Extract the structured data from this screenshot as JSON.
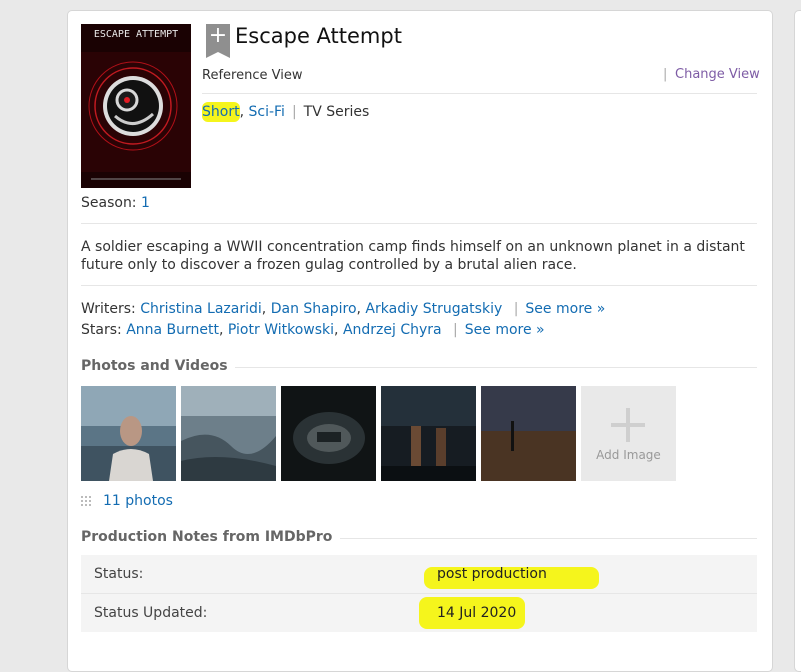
{
  "title": "Escape Attempt",
  "poster": {
    "title_text": "ESCAPE ATTEMPT"
  },
  "view": {
    "reference_label": "Reference View",
    "change_label": "Change View"
  },
  "genres": [
    "Short",
    "Sci-Fi"
  ],
  "type_label": "TV Series",
  "season": {
    "label": "Season:",
    "value": "1"
  },
  "plot": "A soldier escaping a WWII concentration camp finds himself on an unknown planet in a distant future only to discover a frozen gulag controlled by a brutal alien race.",
  "writers": {
    "label": "Writers:",
    "names": [
      "Christina Lazaridi",
      "Dan Shapiro",
      "Arkadiy Strugatskiy"
    ],
    "see_more": "See more »"
  },
  "stars": {
    "label": "Stars:",
    "names": [
      "Anna Burnett",
      "Piotr Witkowski",
      "Andrzej Chyra"
    ],
    "see_more": "See more »"
  },
  "photos": {
    "section_title": "Photos and Videos",
    "add_image_label": "Add Image",
    "count_label": "11 photos"
  },
  "production": {
    "section_title": "Production Notes from IMDbPro",
    "rows": [
      {
        "label": "Status:",
        "value": "post production"
      },
      {
        "label": "Status Updated:",
        "value": "14 Jul 2020"
      }
    ]
  },
  "colors": {
    "link": "#136cb2",
    "change_view": "#7e5ca5",
    "highlight": "#f5f51c"
  }
}
